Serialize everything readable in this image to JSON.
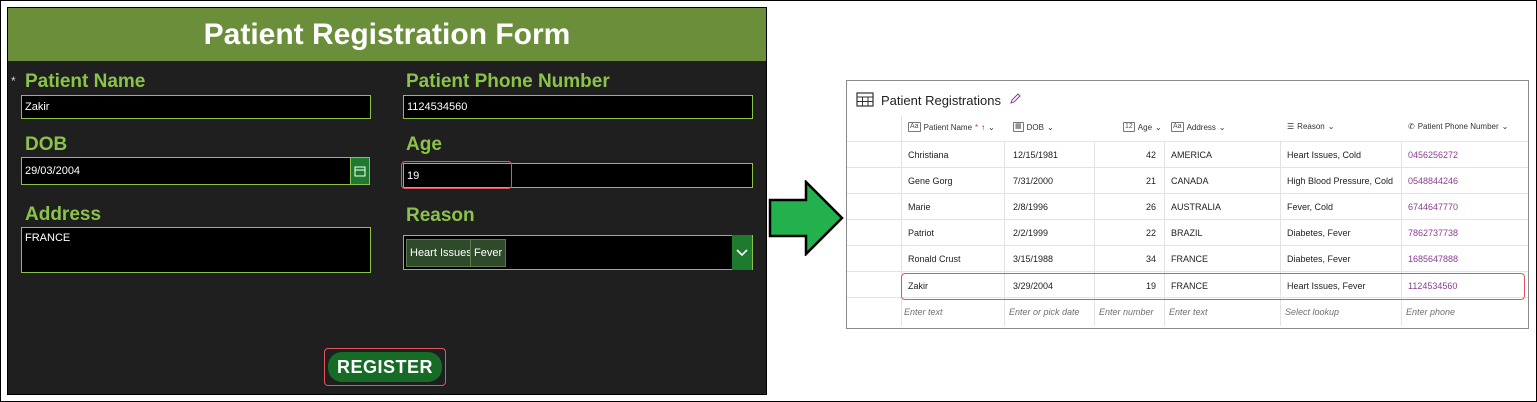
{
  "form": {
    "title": "Patient Registration Form",
    "required_marker": "*",
    "fields": {
      "name": {
        "label": "Patient Name",
        "value": "Zakir"
      },
      "phone": {
        "label": "Patient Phone Number",
        "value": "1124534560"
      },
      "dob": {
        "label": "DOB",
        "value": "29/03/2004"
      },
      "age": {
        "label": "Age",
        "value": "19"
      },
      "address": {
        "label": "Address",
        "value": "FRANCE"
      },
      "reason": {
        "label": "Reason",
        "chips": [
          "Heart Issues",
          "Fever"
        ]
      }
    },
    "register_label": "REGISTER"
  },
  "table": {
    "title": "Patient Registrations",
    "columns": [
      {
        "key": "name",
        "label": "Patient Name",
        "icon": "text-field-icon",
        "required": "*",
        "sort": "↑"
      },
      {
        "key": "dob",
        "label": "DOB",
        "icon": "calendar-icon"
      },
      {
        "key": "age",
        "label": "Age",
        "icon": "number-field-icon"
      },
      {
        "key": "address",
        "label": "Address",
        "icon": "text-field-icon"
      },
      {
        "key": "reason",
        "label": "Reason",
        "icon": "list-icon"
      },
      {
        "key": "phone",
        "label": "Patient Phone Number",
        "icon": "phone-icon"
      }
    ],
    "rows": [
      {
        "name": "Christiana",
        "dob": "12/15/1981",
        "age": "42",
        "address": "AMERICA",
        "reason": "Heart Issues, Cold",
        "phone": "0456256272"
      },
      {
        "name": "Gene Gorg",
        "dob": "7/31/2000",
        "age": "21",
        "address": "CANADA",
        "reason": "High Blood Pressure, Cold",
        "phone": "0548844246"
      },
      {
        "name": "Marie",
        "dob": "2/8/1996",
        "age": "26",
        "address": "AUSTRALIA",
        "reason": "Fever, Cold",
        "phone": "6744647770"
      },
      {
        "name": "Patriot",
        "dob": "2/2/1999",
        "age": "22",
        "address": "BRAZIL",
        "reason": "Diabetes, Fever",
        "phone": "7862737738"
      },
      {
        "name": "Ronald Crust",
        "dob": "3/15/1988",
        "age": "34",
        "address": "FRANCE",
        "reason": "Diabetes, Fever",
        "phone": "1685647888"
      },
      {
        "name": "Zakir",
        "dob": "3/29/2004",
        "age": "19",
        "address": "FRANCE",
        "reason": "Heart Issues, Fever",
        "phone": "1124534560"
      }
    ],
    "placeholders": {
      "name": "Enter text",
      "dob": "Enter or pick date",
      "age": "Enter number",
      "address": "Enter text",
      "reason": "Select lookup",
      "phone": "Enter phone"
    }
  },
  "colors": {
    "form_bg": "#1f1f1f",
    "header_green": "#6b8e3b",
    "label_green": "#8bc34a",
    "button_green": "#166b26",
    "highlight_red": "#e0555f",
    "arrow_green": "#22b14c",
    "phone_purple": "#8a3f8f"
  }
}
